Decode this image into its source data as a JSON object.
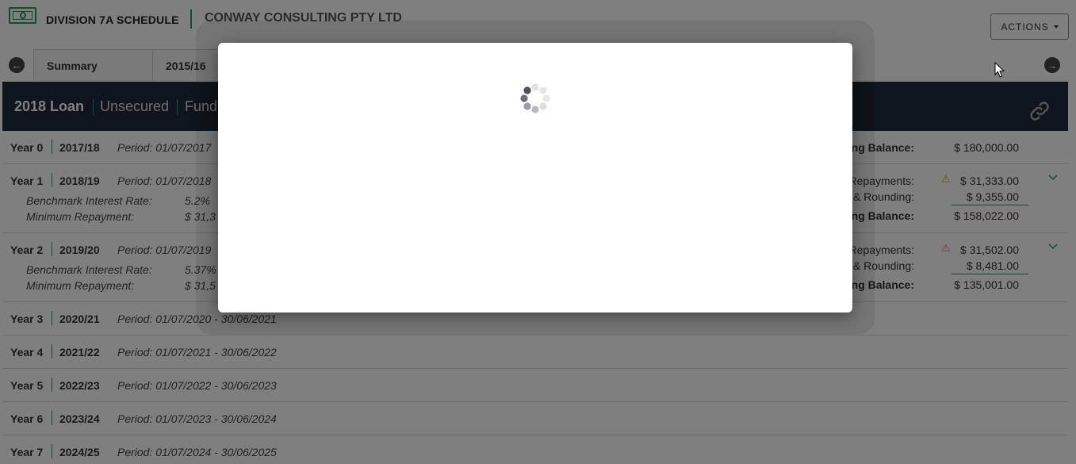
{
  "header": {
    "app_title": "DIVISION 7A SCHEDULE",
    "company": "CONWAY CONSULTING PTY LTD",
    "actions_label": "ACTIONS",
    "logo_icon": "money-icon"
  },
  "tabs": [
    {
      "label": "Summary"
    },
    {
      "label": "2015/16"
    }
  ],
  "banner": {
    "title": "2018 Loan",
    "security": "Unsecured",
    "fund": "Fund"
  },
  "rows": [
    {
      "year": "Year 0",
      "fy": "2017/18",
      "period": "Period: 01/07/2017",
      "balance_label": "ng Balance:",
      "balance": "$ 180,000.00"
    },
    {
      "year": "Year 1",
      "fy": "2018/19",
      "period": "Period: 01/07/2018",
      "benchmark_label": "Benchmark Interest Rate:",
      "benchmark": "5.2%",
      "min_label": "Minimum Repayment:",
      "min": "$ 31,3",
      "repay_label": "Repayments:",
      "repay": "$ 31,333.00",
      "round_label": "& Rounding:",
      "round": "$ 9,355.00",
      "balance_label": "ng Balance:",
      "balance": "$ 158,022.00"
    },
    {
      "year": "Year 2",
      "fy": "2019/20",
      "period": "Period: 01/07/2019",
      "benchmark_label": "Benchmark Interest Rate:",
      "benchmark": "5.37%",
      "min_label": "Minimum Repayment:",
      "min": "$ 31,5",
      "repay_label": "Repayments:",
      "repay": "$ 31,502.00",
      "round_label": "& Rounding:",
      "round": "$ 8,481.00",
      "balance_label": "ng Balance:",
      "balance": "$ 135,001.00"
    },
    {
      "year": "Year 3",
      "fy": "2020/21",
      "period": "Period: 01/07/2020 - 30/06/2021"
    },
    {
      "year": "Year 4",
      "fy": "2021/22",
      "period": "Period: 01/07/2021 - 30/06/2022"
    },
    {
      "year": "Year 5",
      "fy": "2022/23",
      "period": "Period: 01/07/2022 - 30/06/2023"
    },
    {
      "year": "Year 6",
      "fy": "2023/24",
      "period": "Period: 01/07/2023 - 30/06/2024"
    },
    {
      "year": "Year 7",
      "fy": "2024/25",
      "period": "Period: 01/07/2024 - 30/06/2025"
    }
  ],
  "colors": {
    "accent": "#1e9e5c",
    "banner": "#1f2a38",
    "warning": "#e09020"
  }
}
